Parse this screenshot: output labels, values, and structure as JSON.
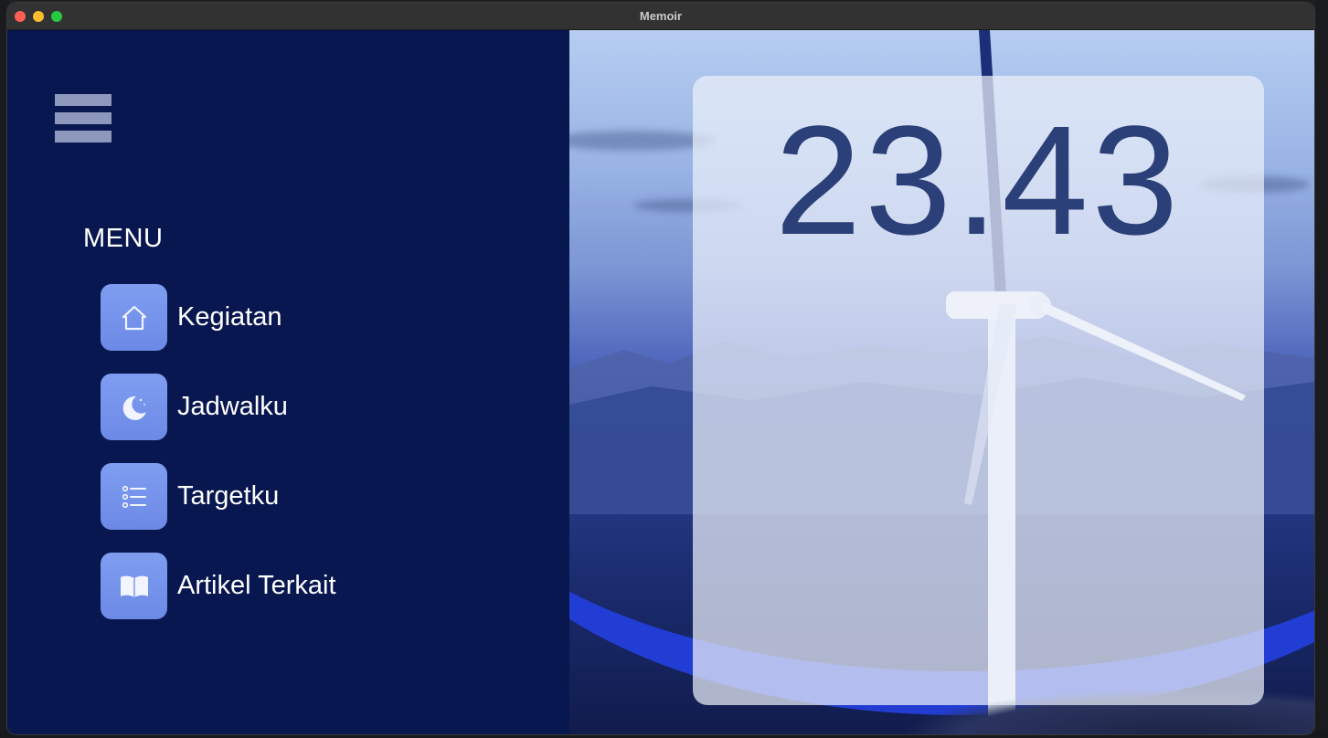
{
  "window": {
    "title": "Memoir"
  },
  "sidebar": {
    "menu_title": "MENU",
    "items": [
      {
        "label": "Kegiatan",
        "icon": "home-icon"
      },
      {
        "label": "Jadwalku",
        "icon": "moon-icon"
      },
      {
        "label": "Targetku",
        "icon": "list-icon"
      },
      {
        "label": "Artikel Terkait",
        "icon": "book-icon"
      }
    ]
  },
  "main": {
    "clock": "23.43"
  },
  "colors": {
    "sidebar_bg": "#08174f",
    "icon_bg": "#7690ea",
    "clock_text": "#2b3f78",
    "accent_arc": "#2440e0"
  }
}
